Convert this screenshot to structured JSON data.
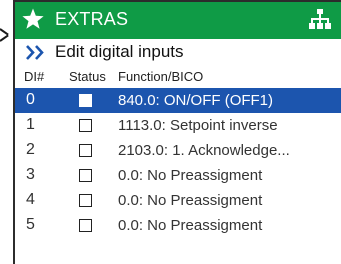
{
  "header": {
    "title": "EXTRAS",
    "icon_left": "star-icon",
    "icon_right": "network-icon"
  },
  "subheader": {
    "icon": "double-chevron-right-icon",
    "title": "Edit digital inputs"
  },
  "columns": {
    "di": "DI#",
    "status": "Status",
    "function": "Function/BICO"
  },
  "rows": [
    {
      "num": "0",
      "status_checked": false,
      "function": "840.0: ON/OFF (OFF1)",
      "selected": true
    },
    {
      "num": "1",
      "status_checked": false,
      "function": "1113.0: Setpoint inverse",
      "selected": false
    },
    {
      "num": "2",
      "status_checked": false,
      "function": "2103.0: 1. Acknowledge...",
      "selected": false
    },
    {
      "num": "3",
      "status_checked": false,
      "function": "0.0: No Preassigment",
      "selected": false
    },
    {
      "num": "4",
      "status_checked": false,
      "function": "0.0: No Preassigment",
      "selected": false
    },
    {
      "num": "5",
      "status_checked": false,
      "function": "0.0: No Preassigment",
      "selected": false
    }
  ],
  "colors": {
    "header_bg": "#0f9b46",
    "selection_bg": "#1c55ae",
    "chevron": "#1c55ae"
  }
}
